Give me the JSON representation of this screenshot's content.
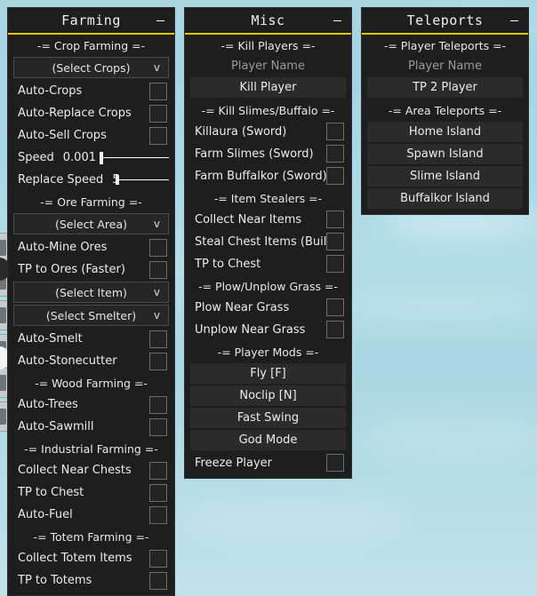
{
  "background": {
    "sky_color": "#a9d5e3",
    "description": "light blue sky"
  },
  "theme": {
    "panel_bg": "#1e1e1e",
    "accent": "#e3c700",
    "text": "#ececec",
    "button_bg": "#2b2b2b",
    "checkbox_border": "#6c6c6c"
  },
  "panels": [
    {
      "id": "farming",
      "title": "Farming",
      "minimize_label": "–",
      "rows": [
        {
          "type": "section",
          "name": "section-crop-farming",
          "label": "-= Crop Farming =-"
        },
        {
          "type": "dropdown",
          "name": "select-crops-dropdown",
          "label": "(Select Crops)",
          "caret": "v"
        },
        {
          "type": "toggle",
          "name": "toggle-auto-crops",
          "label": "Auto-Crops",
          "checked": false
        },
        {
          "type": "toggle",
          "name": "toggle-auto-replace-crops",
          "label": "Auto-Replace Crops",
          "checked": false
        },
        {
          "type": "toggle",
          "name": "toggle-auto-sell-crops",
          "label": "Auto-Sell Crops",
          "checked": false
        },
        {
          "type": "slider",
          "name": "slider-speed",
          "label": "Speed",
          "value": "0.001"
        },
        {
          "type": "slider",
          "name": "slider-replace-speed",
          "label": "Replace Speed",
          "value": "5"
        },
        {
          "type": "section",
          "name": "section-ore-farming",
          "label": "-= Ore Farming =-"
        },
        {
          "type": "dropdown",
          "name": "select-area-dropdown",
          "label": "(Select Area)",
          "caret": "v"
        },
        {
          "type": "toggle",
          "name": "toggle-auto-mine-ores",
          "label": "Auto-Mine Ores",
          "checked": false
        },
        {
          "type": "toggle",
          "name": "toggle-tp-to-ores-faster",
          "label": "TP to Ores (Faster)",
          "checked": false
        },
        {
          "type": "dropdown",
          "name": "select-item-dropdown",
          "label": "(Select Item)",
          "caret": "v"
        },
        {
          "type": "dropdown",
          "name": "select-smelter-dropdown",
          "label": "(Select Smelter)",
          "caret": "v"
        },
        {
          "type": "toggle",
          "name": "toggle-auto-smelt",
          "label": "Auto-Smelt",
          "checked": false
        },
        {
          "type": "toggle",
          "name": "toggle-auto-stonecutter",
          "label": "Auto-Stonecutter",
          "checked": false
        },
        {
          "type": "section",
          "name": "section-wood-farming",
          "label": "-= Wood Farming =-"
        },
        {
          "type": "toggle",
          "name": "toggle-auto-trees",
          "label": "Auto-Trees",
          "checked": false
        },
        {
          "type": "toggle",
          "name": "toggle-auto-sawmill",
          "label": "Auto-Sawmill",
          "checked": false
        },
        {
          "type": "section",
          "name": "section-industrial-farming",
          "label": "-= Industrial Farming =-"
        },
        {
          "type": "toggle",
          "name": "toggle-collect-near-chests",
          "label": "Collect Near Chests",
          "checked": false
        },
        {
          "type": "toggle",
          "name": "toggle-tp-to-chest",
          "label": "TP to Chest",
          "checked": false
        },
        {
          "type": "toggle",
          "name": "toggle-auto-fuel",
          "label": "Auto-Fuel",
          "checked": false
        },
        {
          "type": "section",
          "name": "section-totem-farming",
          "label": "-= Totem Farming =-"
        },
        {
          "type": "toggle",
          "name": "toggle-collect-totem-items",
          "label": "Collect Totem Items",
          "checked": false
        },
        {
          "type": "toggle",
          "name": "toggle-tp-to-totems",
          "label": "TP to Totems",
          "checked": false
        }
      ]
    },
    {
      "id": "misc",
      "title": "Misc",
      "minimize_label": "–",
      "rows": [
        {
          "type": "section",
          "name": "section-kill-players",
          "label": "-= Kill Players =-"
        },
        {
          "type": "input",
          "name": "player-name-input",
          "value": "",
          "placeholder": "Player Name"
        },
        {
          "type": "button",
          "name": "kill-player-button",
          "label": "Kill Player"
        },
        {
          "type": "section",
          "name": "section-kill-slimes-buffalo",
          "label": "-= Kill Slimes/Buffalo =-"
        },
        {
          "type": "toggle",
          "name": "toggle-killaura-sword",
          "label": "Killaura (Sword)",
          "checked": false
        },
        {
          "type": "toggle",
          "name": "toggle-farm-slimes-sword",
          "label": "Farm Slimes (Sword)",
          "checked": false
        },
        {
          "type": "toggle",
          "name": "toggle-farm-buffalkor-sword",
          "label": "Farm Buffalkor (Sword)",
          "checked": false
        },
        {
          "type": "section",
          "name": "section-item-stealers",
          "label": "-= Item Stealers =-"
        },
        {
          "type": "toggle",
          "name": "toggle-collect-near-items",
          "label": "Collect Near Items",
          "checked": false
        },
        {
          "type": "toggle",
          "name": "toggle-steal-chest-items-build",
          "label": "Steal Chest Items (Build)",
          "checked": false
        },
        {
          "type": "toggle",
          "name": "toggle-tp-to-chest",
          "label": "TP to Chest",
          "checked": false
        },
        {
          "type": "section",
          "name": "section-plow-unplow-grass",
          "label": "-= Plow/Unplow Grass =-"
        },
        {
          "type": "toggle",
          "name": "toggle-plow-near-grass",
          "label": "Plow Near Grass",
          "checked": false
        },
        {
          "type": "toggle",
          "name": "toggle-unplow-near-grass",
          "label": "Unplow Near Grass",
          "checked": false
        },
        {
          "type": "section",
          "name": "section-player-mods",
          "label": "-= Player Mods =-"
        },
        {
          "type": "button",
          "name": "fly-button",
          "label": "Fly [F]"
        },
        {
          "type": "button",
          "name": "noclip-button",
          "label": "Noclip [N]"
        },
        {
          "type": "button",
          "name": "fast-swing-button",
          "label": "Fast Swing"
        },
        {
          "type": "button",
          "name": "god-mode-button",
          "label": "God Mode"
        },
        {
          "type": "toggle",
          "name": "toggle-freeze-player",
          "label": "Freeze Player",
          "checked": false
        }
      ]
    },
    {
      "id": "teleports",
      "title": "Teleports",
      "minimize_label": "–",
      "rows": [
        {
          "type": "section",
          "name": "section-player-teleports",
          "label": "-= Player Teleports =-"
        },
        {
          "type": "input",
          "name": "player-name-input",
          "value": "",
          "placeholder": "Player Name"
        },
        {
          "type": "button",
          "name": "tp-2-player-button",
          "label": "TP 2 Player"
        },
        {
          "type": "section",
          "name": "section-area-teleports",
          "label": "-= Area Teleports =-"
        },
        {
          "type": "button",
          "name": "home-island-button",
          "label": "Home Island"
        },
        {
          "type": "button",
          "name": "spawn-island-button",
          "label": "Spawn Island"
        },
        {
          "type": "button",
          "name": "slime-island-button",
          "label": "Slime Island"
        },
        {
          "type": "button",
          "name": "buffalkor-island-button",
          "label": "Buffalkor Island"
        }
      ]
    }
  ]
}
